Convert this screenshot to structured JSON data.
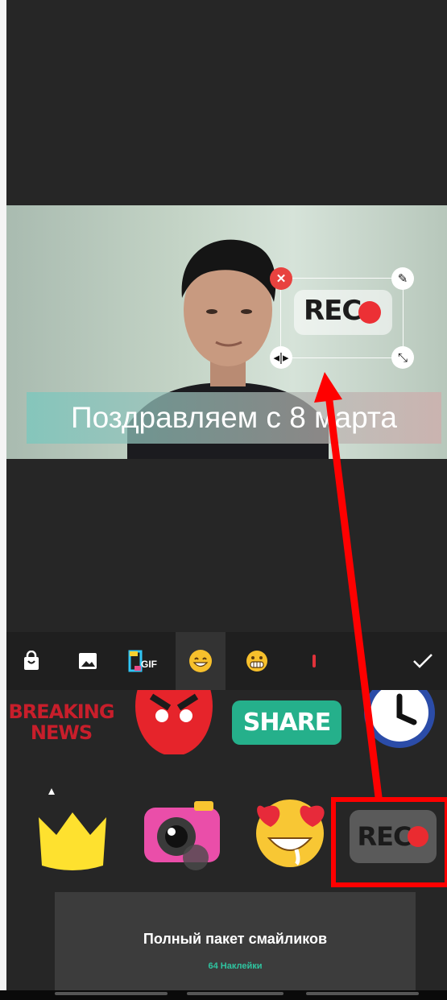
{
  "preview": {
    "caption_text": "Поздравляем с 8 марта",
    "selected_sticker_text": "REC"
  },
  "tabs": [
    {
      "icon": "shopping-bag-icon"
    },
    {
      "icon": "image-icon"
    },
    {
      "icon": "gif-icon",
      "label": "GIF"
    },
    {
      "icon": "grin-emoji-icon",
      "active": true
    },
    {
      "icon": "grimace-emoji-icon"
    },
    {
      "icon": "partial-sticker-icon"
    }
  ],
  "confirm_icon": "checkmark-icon",
  "stickers": {
    "breaking_news_line1": "BREAKING",
    "breaking_news_line2": "NEWS",
    "share_label": "SHARE",
    "rec_label": "REC"
  },
  "pack": {
    "title": "Полный пакет смайликов",
    "subtitle": "64 Наклейки"
  },
  "colors": {
    "accent": "#2fc4a0",
    "annotation": "#ff0000",
    "rec_dot": "#ec3035"
  }
}
